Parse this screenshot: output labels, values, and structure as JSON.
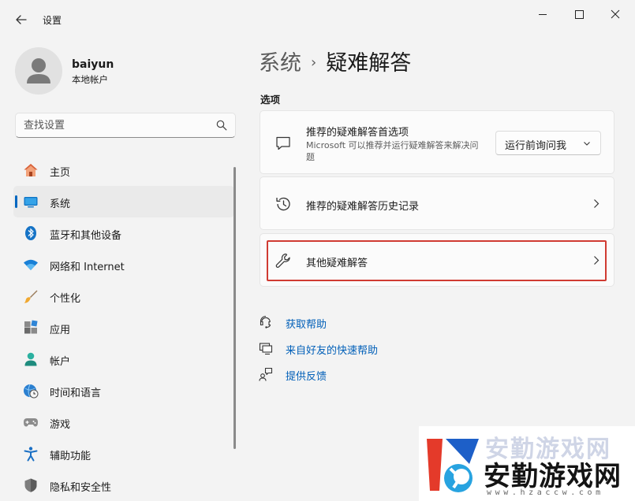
{
  "window": {
    "title": "设置"
  },
  "user": {
    "name": "baiyun",
    "account_type": "本地帐户"
  },
  "search": {
    "placeholder": "查找设置"
  },
  "sidebar": {
    "items": [
      {
        "label": "主页",
        "icon": "home-icon"
      },
      {
        "label": "系统",
        "icon": "system-icon",
        "selected": true
      },
      {
        "label": "蓝牙和其他设备",
        "icon": "bluetooth-icon"
      },
      {
        "label": "网络和 Internet",
        "icon": "wifi-icon"
      },
      {
        "label": "个性化",
        "icon": "brush-icon"
      },
      {
        "label": "应用",
        "icon": "apps-icon"
      },
      {
        "label": "帐户",
        "icon": "account-icon"
      },
      {
        "label": "时间和语言",
        "icon": "globe-clock-icon"
      },
      {
        "label": "游戏",
        "icon": "gamepad-icon"
      },
      {
        "label": "辅助功能",
        "icon": "accessibility-icon"
      },
      {
        "label": "隐私和安全性",
        "icon": "shield-icon"
      }
    ]
  },
  "breadcrumb": {
    "parent": "系统",
    "separator": "›",
    "current": "疑难解答"
  },
  "main": {
    "section_label": "选项",
    "cards": [
      {
        "title": "推荐的疑难解答首选项",
        "description": "Microsoft 可以推荐并运行疑难解答来解决问题",
        "icon": "chat-bubble-icon",
        "dropdown_value": "运行前询问我"
      },
      {
        "title": "推荐的疑难解答历史记录",
        "icon": "history-icon"
      },
      {
        "title": "其他疑难解答",
        "icon": "wrench-icon"
      }
    ],
    "links": [
      {
        "label": "获取帮助",
        "icon": "help-icon"
      },
      {
        "label": "来自好友的快速帮助",
        "icon": "remote-assist-icon"
      },
      {
        "label": "提供反馈",
        "icon": "feedback-icon"
      }
    ]
  },
  "watermark": {
    "brand": "安勤游戏网",
    "url": "www.hzaccw.com",
    "faint_text": "安勤游戏网"
  },
  "colors": {
    "accent": "#0067c0",
    "link": "#005fb8",
    "highlight": "#d03b32",
    "background": "#f3f3f3",
    "card": "#fbfbfb"
  }
}
